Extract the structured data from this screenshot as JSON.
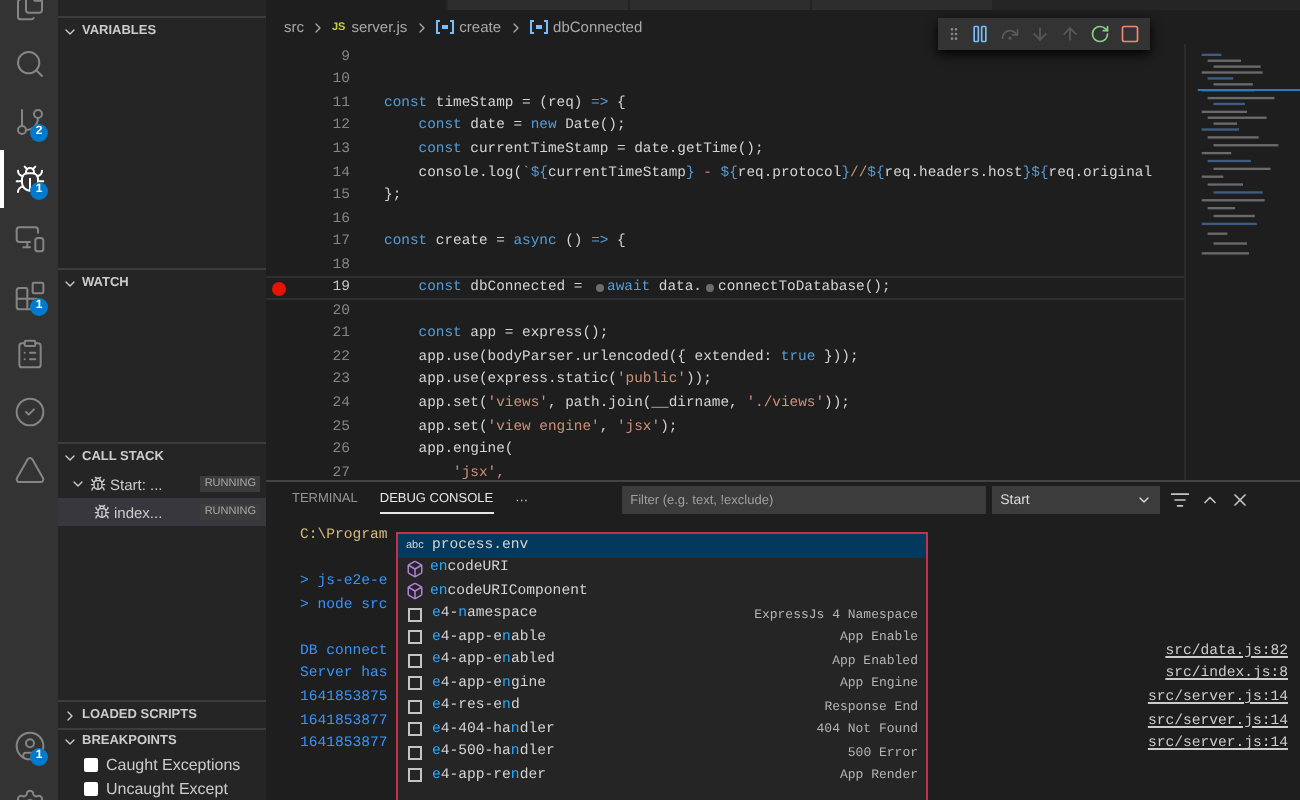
{
  "activity_bar": {
    "items": [
      {
        "kind": "files",
        "selected": false
      },
      {
        "kind": "search",
        "selected": false
      },
      {
        "kind": "source_control",
        "selected": false,
        "badge": "2"
      },
      {
        "kind": "run_debug",
        "selected": true,
        "badge": "1"
      },
      {
        "kind": "remote",
        "selected": false
      },
      {
        "kind": "extensions",
        "selected": false,
        "badge": "1"
      },
      {
        "kind": "clipboard",
        "selected": false
      },
      {
        "kind": "testing",
        "selected": false
      },
      {
        "kind": "azure",
        "selected": false
      }
    ],
    "bottom_items": [
      {
        "kind": "account",
        "badge": "1"
      },
      {
        "kind": "settings"
      }
    ]
  },
  "sidebar": {
    "sections": [
      {
        "title": "VARIABLES",
        "expanded": true,
        "kind": "variables"
      },
      {
        "title": "WATCH",
        "expanded": true,
        "kind": "watch"
      },
      {
        "title": "CALL STACK",
        "expanded": true,
        "kind": "call_stack",
        "items": [
          {
            "label": "Start: ...",
            "status": "RUNNING",
            "expanded": true,
            "selected": false,
            "children": [
              {
                "label": "index...",
                "status": "RUNNING",
                "selected": true
              }
            ]
          }
        ]
      },
      {
        "title": "LOADED SCRIPTS",
        "expanded": false,
        "kind": "loaded_scripts"
      },
      {
        "title": "BREAKPOINTS",
        "expanded": true,
        "kind": "breakpoints",
        "items": [
          {
            "label": "Caught Exceptions",
            "checked": false
          },
          {
            "label": "Uncaught Except",
            "checked": false
          }
        ]
      }
    ]
  },
  "editor": {
    "breadcrumb": [
      {
        "kind": "folder",
        "label": "src"
      },
      {
        "kind": "file",
        "icon_label": "JS",
        "label": "server.js"
      },
      {
        "kind": "symbol",
        "label": "create"
      },
      {
        "kind": "symbol",
        "label": "dbConnected"
      }
    ],
    "debug_toolbar": [
      {
        "kind": "pause",
        "disabled": false
      },
      {
        "kind": "step_over",
        "disabled": true
      },
      {
        "kind": "step_into",
        "disabled": true
      },
      {
        "kind": "step_out",
        "disabled": true
      },
      {
        "kind": "restart",
        "disabled": false
      },
      {
        "kind": "stop",
        "disabled": false
      }
    ],
    "lines": [
      {
        "number": "9",
        "breakpoint": false,
        "highlighted": false
      },
      {
        "number": "10",
        "breakpoint": false,
        "highlighted": false
      },
      {
        "number": "11",
        "breakpoint": false,
        "highlighted": false,
        "tokens": [
          {
            "kind": "keyword",
            "text": "const "
          },
          {
            "kind": "plain",
            "text": "timeStamp = (req) "
          },
          {
            "kind": "keyword",
            "text": "=>"
          },
          {
            "kind": "plain",
            "text": " {"
          }
        ]
      },
      {
        "number": "12",
        "breakpoint": false,
        "highlighted": false,
        "tokens": [
          {
            "kind": "keyword",
            "text": "    const "
          },
          {
            "kind": "plain",
            "text": "date = "
          },
          {
            "kind": "keyword",
            "text": "new "
          },
          {
            "kind": "plain",
            "text": "Date();"
          }
        ]
      },
      {
        "number": "13",
        "breakpoint": false,
        "highlighted": false,
        "tokens": [
          {
            "kind": "keyword",
            "text": "    const "
          },
          {
            "kind": "plain",
            "text": "currentTimeStamp = date.getTime();"
          }
        ]
      },
      {
        "number": "14",
        "breakpoint": false,
        "highlighted": false,
        "tokens": [
          {
            "kind": "plain",
            "text": "    console.log("
          },
          {
            "kind": "string",
            "text": "`"
          },
          {
            "kind": "keyword",
            "text": "${"
          },
          {
            "kind": "plain",
            "text": "currentTimeStamp"
          },
          {
            "kind": "keyword",
            "text": "}"
          },
          {
            "kind": "string",
            "text": " - "
          },
          {
            "kind": "keyword",
            "text": "${"
          },
          {
            "kind": "plain",
            "text": "req.protocol"
          },
          {
            "kind": "keyword",
            "text": "}"
          },
          {
            "kind": "string",
            "text": "//"
          },
          {
            "kind": "keyword",
            "text": "${"
          },
          {
            "kind": "plain",
            "text": "req.headers.host"
          },
          {
            "kind": "keyword",
            "text": "}${"
          },
          {
            "kind": "plain",
            "text": "req.original"
          }
        ]
      },
      {
        "number": "15",
        "breakpoint": false,
        "highlighted": false,
        "tokens": [
          {
            "kind": "plain",
            "text": "};"
          }
        ]
      },
      {
        "number": "16",
        "breakpoint": false,
        "highlighted": false
      },
      {
        "number": "17",
        "breakpoint": false,
        "highlighted": false,
        "tokens": [
          {
            "kind": "keyword",
            "text": "const "
          },
          {
            "kind": "plain",
            "text": "create = "
          },
          {
            "kind": "keyword",
            "text": "async "
          },
          {
            "kind": "plain",
            "text": "() "
          },
          {
            "kind": "keyword",
            "text": "=>"
          },
          {
            "kind": "plain",
            "text": " {"
          }
        ]
      },
      {
        "number": "18",
        "breakpoint": false,
        "highlighted": false
      },
      {
        "number": "19",
        "breakpoint": true,
        "highlighted": true,
        "tokens": [
          {
            "kind": "keyword",
            "text": "    const "
          },
          {
            "kind": "plain",
            "text": "dbConnected = "
          },
          {
            "kind": "inline_breakpoint"
          },
          {
            "kind": "keyword",
            "text": "await "
          },
          {
            "kind": "plain",
            "text": "data."
          },
          {
            "kind": "inline_breakpoint"
          },
          {
            "kind": "plain",
            "text": "connectToDatabase();"
          }
        ]
      },
      {
        "number": "20",
        "breakpoint": false,
        "highlighted": false
      },
      {
        "number": "21",
        "breakpoint": false,
        "highlighted": false,
        "tokens": [
          {
            "kind": "keyword",
            "text": "    const "
          },
          {
            "kind": "plain",
            "text": "app = express();"
          }
        ]
      },
      {
        "number": "22",
        "breakpoint": false,
        "highlighted": false,
        "tokens": [
          {
            "kind": "plain",
            "text": "    app.use(bodyParser.urlencoded({ extended: "
          },
          {
            "kind": "keyword",
            "text": "true"
          },
          {
            "kind": "plain",
            "text": " }));"
          }
        ]
      },
      {
        "number": "23",
        "breakpoint": false,
        "highlighted": false,
        "tokens": [
          {
            "kind": "plain",
            "text": "    app.use(express.static("
          },
          {
            "kind": "string",
            "text": "'public'"
          },
          {
            "kind": "plain",
            "text": "));"
          }
        ]
      },
      {
        "number": "24",
        "breakpoint": false,
        "highlighted": false,
        "tokens": [
          {
            "kind": "plain",
            "text": "    app.set("
          },
          {
            "kind": "string",
            "text": "'views'"
          },
          {
            "kind": "plain",
            "text": ", path.join(__dirname, "
          },
          {
            "kind": "string",
            "text": "'./views'"
          },
          {
            "kind": "plain",
            "text": "));"
          }
        ]
      },
      {
        "number": "25",
        "breakpoint": false,
        "highlighted": false,
        "tokens": [
          {
            "kind": "plain",
            "text": "    app.set("
          },
          {
            "kind": "string",
            "text": "'view engine'"
          },
          {
            "kind": "plain",
            "text": ", "
          },
          {
            "kind": "string",
            "text": "'jsx'"
          },
          {
            "kind": "plain",
            "text": ");"
          }
        ]
      },
      {
        "number": "26",
        "breakpoint": false,
        "highlighted": false,
        "tokens": [
          {
            "kind": "plain",
            "text": "    app.engine("
          }
        ]
      },
      {
        "number": "27",
        "breakpoint": false,
        "highlighted": false,
        "tokens": [
          {
            "kind": "string",
            "text": "        'jsx',"
          }
        ]
      }
    ]
  },
  "panel": {
    "tabs": [
      {
        "label": "TERMINAL",
        "selected": false
      },
      {
        "label": "DEBUG CONSOLE",
        "selected": true
      }
    ],
    "more": "···",
    "filter": {
      "placeholder": "Filter (e.g. text, !exclude)"
    },
    "session": "Start",
    "console": [
      {
        "kind": "path",
        "text": "C:\\Program"
      },
      {
        "kind": "blank"
      },
      {
        "kind": "command",
        "text": "> js-e2e-e"
      },
      {
        "kind": "command",
        "text": "> node src"
      },
      {
        "kind": "blank"
      },
      {
        "kind": "output",
        "text": "DB connect",
        "link": "src/data.js:82"
      },
      {
        "kind": "output",
        "text": "Server has",
        "link": "src/index.js:8"
      },
      {
        "kind": "output",
        "text": "1641853875",
        "link": "src/server.js:14"
      },
      {
        "kind": "output",
        "text": "1641853877",
        "link": "src/server.js:14"
      },
      {
        "kind": "output",
        "text": "1641853877",
        "link": "src/server.js:14"
      }
    ],
    "suggestions": [
      {
        "kind": "text",
        "kind_label": "abc",
        "label": "process.env",
        "selected": true
      },
      {
        "kind": "method",
        "label": "**en**codeURI",
        "selected": false
      },
      {
        "kind": "method",
        "label": "**en**codeURIComponent",
        "selected": false
      },
      {
        "kind": "snippet",
        "label": "**e**4-**n**amespace",
        "detail": "ExpressJs 4 Namespace",
        "selected": false
      },
      {
        "kind": "snippet",
        "label": "**e**4-app-e**n**able",
        "detail": "App Enable",
        "selected": false
      },
      {
        "kind": "snippet",
        "label": "**e**4-app-e**n**abled",
        "detail": "App Enabled",
        "selected": false
      },
      {
        "kind": "snippet",
        "label": "**e**4-app-e**n**gine",
        "detail": "App Engine",
        "selected": false
      },
      {
        "kind": "snippet",
        "label": "**e**4-res-e**n**d",
        "detail": "Response End",
        "selected": false
      },
      {
        "kind": "snippet",
        "label": "**e**4-404-ha**n**dler",
        "detail": "404 Not Found",
        "selected": false
      },
      {
        "kind": "snippet",
        "label": "**e**4-500-ha**n**dler",
        "detail": "500 Error",
        "selected": false
      },
      {
        "kind": "snippet",
        "label": "**e**4-app-re**n**der",
        "detail": "App Render",
        "selected": false
      }
    ]
  }
}
